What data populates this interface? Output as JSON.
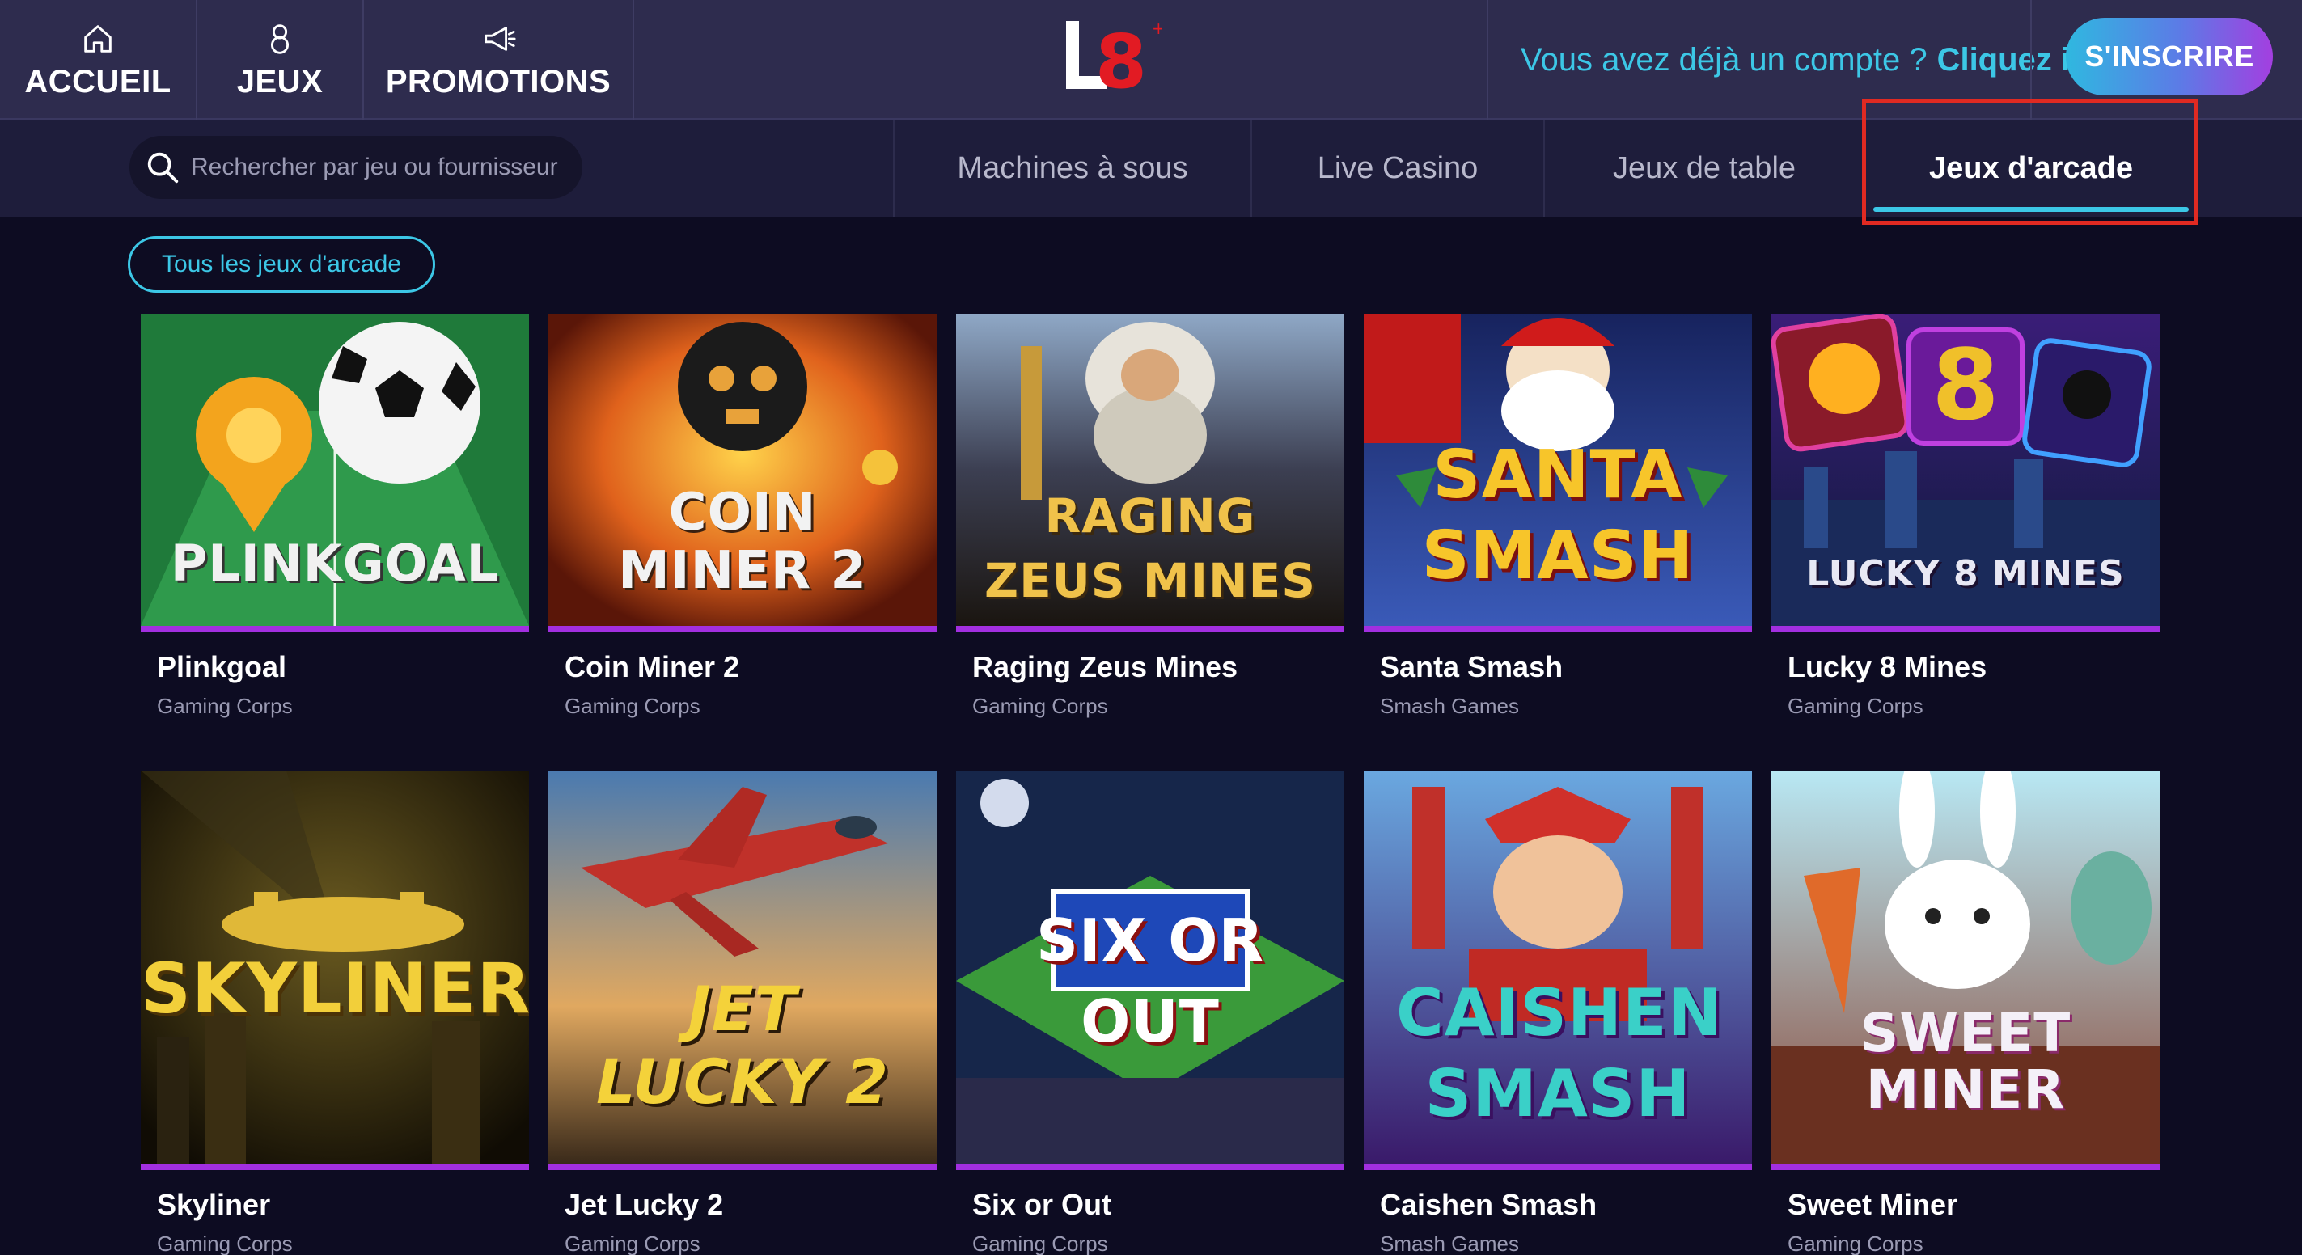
{
  "header": {
    "nav": [
      {
        "label": "ACCUEIL",
        "icon": "home-icon"
      },
      {
        "label": "JEUX",
        "icon": "eight-ball-icon"
      },
      {
        "label": "PROMOTIONS",
        "icon": "megaphone-icon"
      }
    ],
    "logo_text": "L8",
    "account_prompt": "Vous avez déjà un compte ?",
    "login_link": "Cliquez ici",
    "signup_button": "S'INSCRIRE"
  },
  "search": {
    "placeholder": "Rechercher par jeu ou fournisseur",
    "icon": "search-icon"
  },
  "categories": [
    {
      "label": "Machines à sous",
      "active": false
    },
    {
      "label": "Live Casino",
      "active": false
    },
    {
      "label": "Jeux de table",
      "active": false
    },
    {
      "label": "Jeux d'arcade",
      "active": true
    }
  ],
  "filter_chip": "Tous les jeux d'arcade",
  "colors": {
    "background": "#0d0c22",
    "header": "#2e2c4e",
    "subnav": "#1e1d3b",
    "accent_cyan": "#3cc7e6",
    "accent_purple": "#a22fe0",
    "highlight_red": "#e02a22"
  },
  "games": [
    {
      "name": "Plinkgoal",
      "provider": "Gaming Corps",
      "thumb_text": "PLINKGOAL"
    },
    {
      "name": "Coin Miner 2",
      "provider": "Gaming Corps",
      "thumb_text": "COIN MINER 2"
    },
    {
      "name": "Raging Zeus Mines",
      "provider": "Gaming Corps",
      "thumb_text": "RAGING ZEUS MINES"
    },
    {
      "name": "Santa Smash",
      "provider": "Smash Games",
      "thumb_text": "SANTA SMASH"
    },
    {
      "name": "Lucky 8 Mines",
      "provider": "Gaming Corps",
      "thumb_text": "LUCKY 8 MINES"
    },
    {
      "name": "Skyliner",
      "provider": "Gaming Corps",
      "thumb_text": "SKYLINER"
    },
    {
      "name": "Jet Lucky 2",
      "provider": "Gaming Corps",
      "thumb_text": "JET LUCKY 2"
    },
    {
      "name": "Six or Out",
      "provider": "Gaming Corps",
      "thumb_text": "SIX OR OUT"
    },
    {
      "name": "Caishen Smash",
      "provider": "Smash Games",
      "thumb_text": "CAISHEN SMASH"
    },
    {
      "name": "Sweet Miner",
      "provider": "Gaming Corps",
      "thumb_text": "SWEET MINER"
    }
  ]
}
